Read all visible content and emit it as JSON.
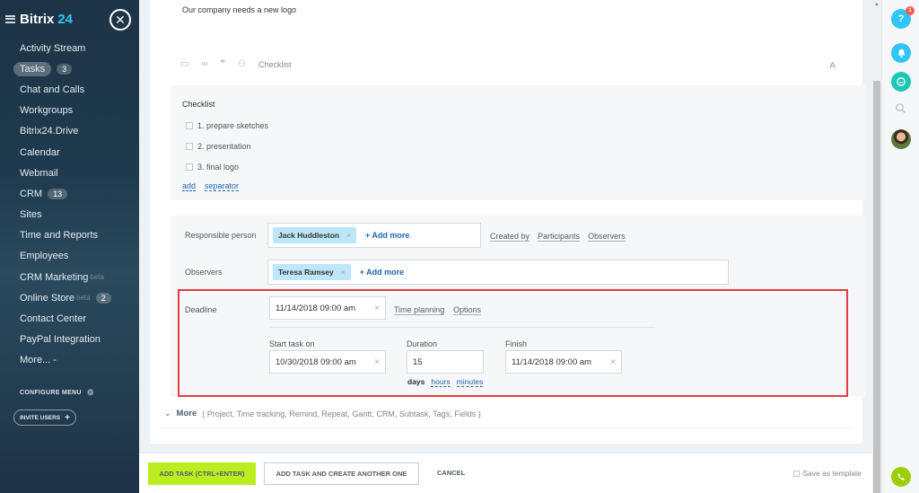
{
  "sidebar": {
    "logo_main": "Bitrix",
    "logo_num": "24",
    "close_symbol": "✕",
    "menu": [
      {
        "label": "Activity Stream"
      },
      {
        "label": "Tasks",
        "counter": "3",
        "active": true
      },
      {
        "label": "Chat and Calls"
      },
      {
        "label": "Workgroups"
      },
      {
        "label": "Bitrix24.Drive"
      },
      {
        "label": "Calendar"
      },
      {
        "label": "Webmail"
      },
      {
        "label": "CRM",
        "counter": "13"
      },
      {
        "label": "Sites"
      },
      {
        "label": "Time and Reports"
      },
      {
        "label": "Employees"
      },
      {
        "label": "CRM Marketing",
        "faded": "beta"
      },
      {
        "label": "Online Store",
        "faded": "beta",
        "counter": "2"
      },
      {
        "label": "Contact Center"
      },
      {
        "label": "PayPal Integration"
      },
      {
        "label": "More... -"
      }
    ],
    "configure_menu": "CONFIGURE MENU",
    "invite_users": "INVITE USERS"
  },
  "task": {
    "description": "Our company needs a new logo",
    "toolbar_checklist": "Checklist",
    "font_toggle": "A",
    "checklist": {
      "title": "Checklist",
      "items": [
        "1. prepare sketches",
        "2. presentation",
        "3. final logo"
      ],
      "add_link": "add",
      "separator_link": "separator"
    },
    "responsible": {
      "label": "Responsible person",
      "person": "Jack Huddleston",
      "add_more": "+ Add more",
      "links": [
        "Created by",
        "Participants",
        "Observers"
      ]
    },
    "observers": {
      "label": "Observers",
      "person": "Teresa Ramsey",
      "add_more": "+ Add more"
    },
    "deadline": {
      "label": "Deadline",
      "value": "11/14/2018 09:00 am",
      "time_planning": "Time planning",
      "options": "Options",
      "start_label": "Start task on",
      "start_value": "10/30/2018 09:00 am",
      "duration_label": "Duration",
      "duration_value": "15",
      "finish_label": "Finish",
      "finish_value": "11/14/2018 09:00 am",
      "units": [
        "days",
        "hours",
        "minutes"
      ]
    },
    "more": {
      "label": "More",
      "items": "( Project,  Time tracking,  Remind,  Repeat,  Gantt,  CRM,  Subtask,  Tags,  Fields )"
    }
  },
  "footer": {
    "add_task": "ADD TASK (CTRL+ENTER)",
    "add_another": "ADD TASK AND CREATE ANOTHER ONE",
    "cancel": "CANCEL",
    "save_template": "Save as template"
  },
  "rightbar": {
    "help": "?",
    "help_badge": "1"
  },
  "colors": {
    "accent": "#2067b0",
    "primary_button": "#bbed21",
    "highlight_frame": "#e53e3e",
    "chip": "#bde7f8",
    "help_btn": "#2fc6f6",
    "bell_btn": "#2fc6f6",
    "chat_btn": "#1ec6b4",
    "phone_btn": "#9dcf00"
  }
}
